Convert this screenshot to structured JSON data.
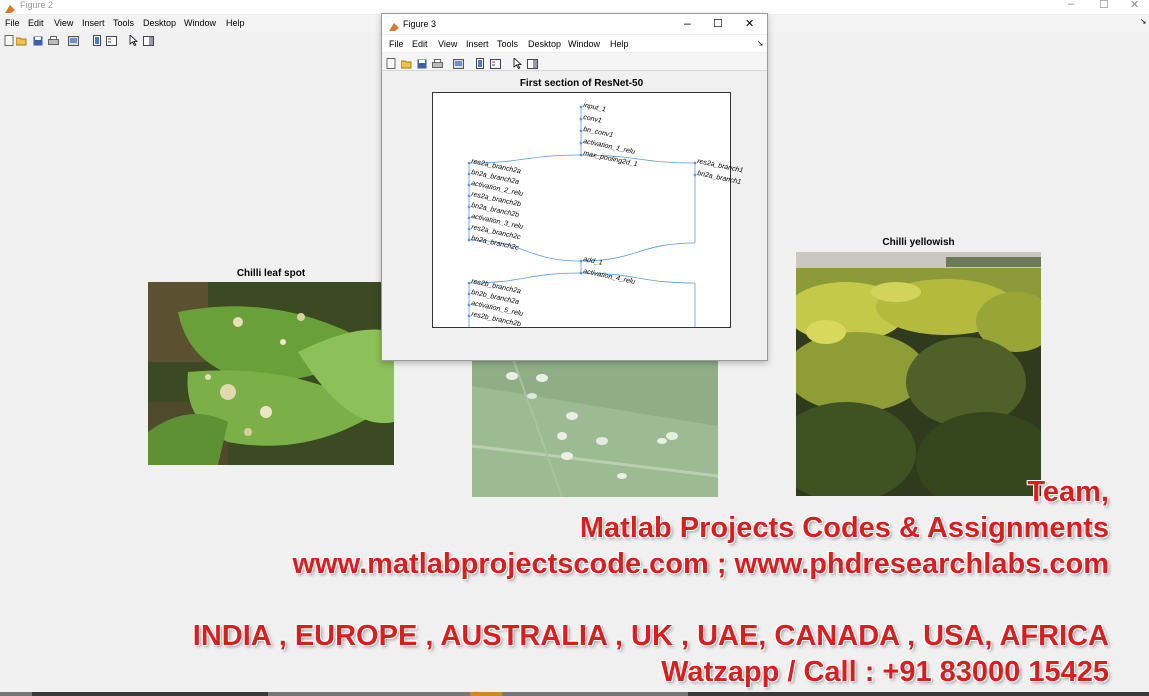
{
  "figure2": {
    "title": "Figure 2",
    "menu": [
      "File",
      "Edit",
      "View",
      "Insert",
      "Tools",
      "Desktop",
      "Window",
      "Help"
    ],
    "toolbar_icons": [
      "new-file-icon",
      "open-folder-icon",
      "save-icon",
      "print-icon",
      "print-preview-icon",
      "colorbar-icon",
      "legend-icon",
      "pointer-icon",
      "property-editor-icon"
    ],
    "subplots": [
      {
        "title": "Chilli leaf spot"
      },
      {
        "title": ""
      },
      {
        "title": "Chilli yellowish"
      }
    ]
  },
  "figure3": {
    "title": "Figure 3",
    "menu": [
      "File",
      "Edit",
      "View",
      "Insert",
      "Tools",
      "Desktop",
      "Window",
      "Help"
    ],
    "toolbar_icons": [
      "new-file-icon",
      "open-folder-icon",
      "save-icon",
      "print-icon",
      "print-preview-icon",
      "colorbar-icon",
      "legend-icon",
      "pointer-icon",
      "property-editor-icon"
    ],
    "plot_title": "First section of ResNet-50",
    "nodes": {
      "main": [
        "input_1",
        "conv1",
        "bn_conv1",
        "activation_1_relu",
        "max_pooling2d_1"
      ],
      "branch1": [
        "res2a_branch1",
        "bn2a_branch1"
      ],
      "branch2": [
        "res2a_branch2a",
        "bn2a_branch2a",
        "activation_2_relu",
        "res2a_branch2b",
        "bn2a_branch2b",
        "activation_3_relu",
        "res2a_branch2c",
        "bn2a_branch2c"
      ],
      "merge": [
        "add_1",
        "activation_4_relu"
      ],
      "branch3": [
        "res2b_branch2a",
        "bn2b_branch2a",
        "activation_5_relu",
        "res2b_branch2b"
      ]
    },
    "edge_color": "#5b9bd5"
  },
  "overlay": {
    "line1": "Team,",
    "line2": "Matlab Projects Codes & Assignments",
    "line3": "www.matlabprojectscode.com ; www.phdresearchlabs.com",
    "line4": "INDIA , EUROPE , AUSTRALIA , UK , UAE, CANADA , USA, AFRICA",
    "line5": "Watzapp / Call : +91 83000 15425",
    "color": "#d81e1e"
  }
}
